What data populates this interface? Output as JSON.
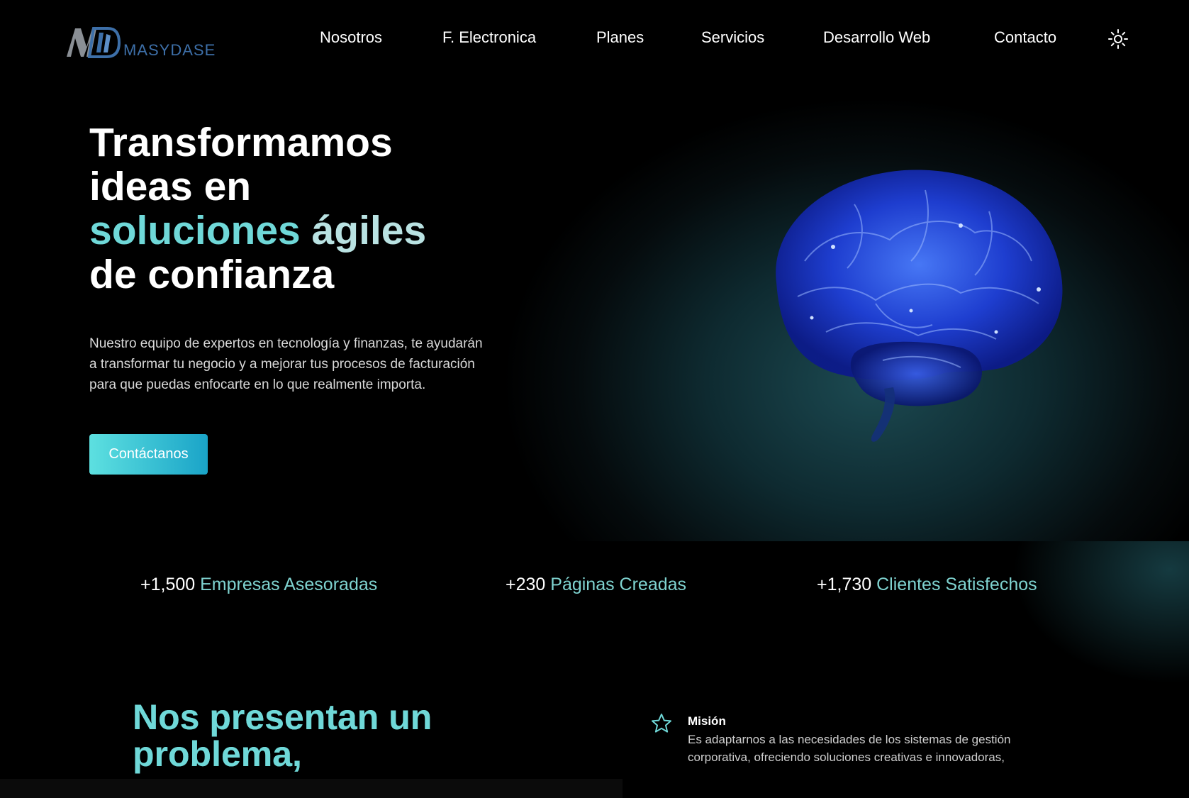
{
  "brand": {
    "name": "MASYDASE",
    "logo_letters": "MD"
  },
  "nav": {
    "items": [
      {
        "label": "Nosotros"
      },
      {
        "label": "F. Electronica"
      },
      {
        "label": "Planes"
      },
      {
        "label": "Servicios"
      },
      {
        "label": "Desarrollo Web"
      },
      {
        "label": "Contacto"
      }
    ],
    "theme_icon": "sun-icon"
  },
  "hero": {
    "title_line1": "Transformamos",
    "title_line2": "ideas en",
    "title_accent1": "soluciones",
    "title_accent2": "ágiles",
    "title_line4": "de confianza",
    "description": "Nuestro equipo de expertos en tecnología y finanzas, te ayudarán a transformar tu negocio y a mejorar tus procesos de facturación para que puedas enfocarte en lo que realmente importa.",
    "cta_label": "Contáctanos",
    "image_icon": "brain-illustration"
  },
  "stats": [
    {
      "number": "+1,500",
      "label": "Empresas Asesoradas"
    },
    {
      "number": "+230",
      "label": "Páginas Creadas"
    },
    {
      "number": "+1,730",
      "label": "Clientes Satisfechos"
    }
  ],
  "about": {
    "title_line1": "Nos presentan un",
    "title_line2": "problema,",
    "mission_icon": "star-icon",
    "mission_label": "Misión",
    "mission_text": "Es adaptarnos a las necesidades de los sistemas de gestión corporativa, ofreciendo soluciones creativas e innovadoras,"
  },
  "colors": {
    "accent": "#6fd8d8",
    "cta_start": "#5de0e0",
    "cta_end": "#1aa4c8",
    "logo_blue": "#3d6fa8",
    "background": "#000000"
  }
}
